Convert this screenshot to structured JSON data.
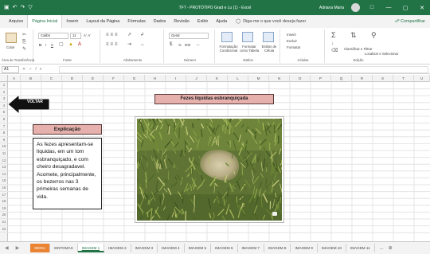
{
  "window": {
    "title": "TFT - PROTÓTIPO Grad e Lu (1) - Excel",
    "user": "Adriana Maria",
    "controls": [
      "—",
      "▢",
      "✕"
    ]
  },
  "quick_access": {
    "save_icon": "save-icon",
    "undo_icon": "undo-icon",
    "redo_icon": "redo-icon"
  },
  "ribbon_tabs": [
    "Arquivo",
    "Página Inicial",
    "Inserir",
    "Layout da Página",
    "Fórmulas",
    "Dados",
    "Revisão",
    "Exibir",
    "Ajuda"
  ],
  "active_tab": "Página Inicial",
  "tell_me": "Diga-me o que você deseja fazer",
  "share_label": "Compartilhar",
  "ribbon": {
    "clipboard": {
      "label": "Área de Transferência",
      "paste": "Colar"
    },
    "font": {
      "label": "Fonte",
      "family": "Calibri",
      "size": "11",
      "bold": "N",
      "italic": "I",
      "underline": "S"
    },
    "alignment": {
      "label": "Alinhamento"
    },
    "number": {
      "label": "Número",
      "format": "Geral",
      "percent": "%",
      "thousands": "000"
    },
    "styles": {
      "label": "Estilos",
      "conditional": "Formatação Condicional",
      "as_table": "Formatar como Tabela",
      "cell_styles": "Estilos de Célula"
    },
    "cells": {
      "label": "Células",
      "insert": "Inserir",
      "delete": "Excluir",
      "format": "Formatar"
    },
    "editing": {
      "label": "Edição",
      "sort": "Classificar e Filtrar",
      "find": "Localizar e Selecionar"
    }
  },
  "formula_bar": {
    "name_box": "A1",
    "fx": "fx",
    "value": ""
  },
  "columns": [
    "A",
    "B",
    "C",
    "D",
    "E",
    "F",
    "G",
    "H",
    "I",
    "J",
    "K",
    "L",
    "M",
    "N",
    "O",
    "P",
    "Q",
    "R",
    "S",
    "T",
    "U"
  ],
  "rows": [
    "1",
    "2",
    "3",
    "4",
    "5",
    "6",
    "7",
    "8",
    "9",
    "10",
    "11",
    "12",
    "13",
    "14",
    "15",
    "16",
    "17",
    "18",
    "19",
    "20",
    "21",
    "22"
  ],
  "sheet": {
    "back_button": "VOLTAR",
    "title": "Fezes líquidas esbranquiçada",
    "explanation_heading": "Explicação",
    "explanation_text": "As fezes apresentam-se líquidas,  em um tom esbranquiçado, e com cheiro desagradavel. Acomete, principalmente, os bezerros nas 3 primeiras semanas de vida."
  },
  "sheet_tabs": [
    "MENU",
    "SINTOMAS",
    "IMAGEM 1",
    "IMAGEM 2",
    "IMAGEM 3",
    "IMAGEM 4",
    "IMAGEM 5",
    "IMAGEM 6",
    "IMAGEM 7",
    "IMAGEM 8",
    "IMAGEM 9",
    "IMAGEM 10",
    "IMAGEM 11"
  ],
  "active_sheet": "IMAGEM 1",
  "sheet_more": "...",
  "colors": {
    "excel_green": "#217346",
    "banner": "#e6b1ad",
    "menu_tab": "#ea8433"
  }
}
